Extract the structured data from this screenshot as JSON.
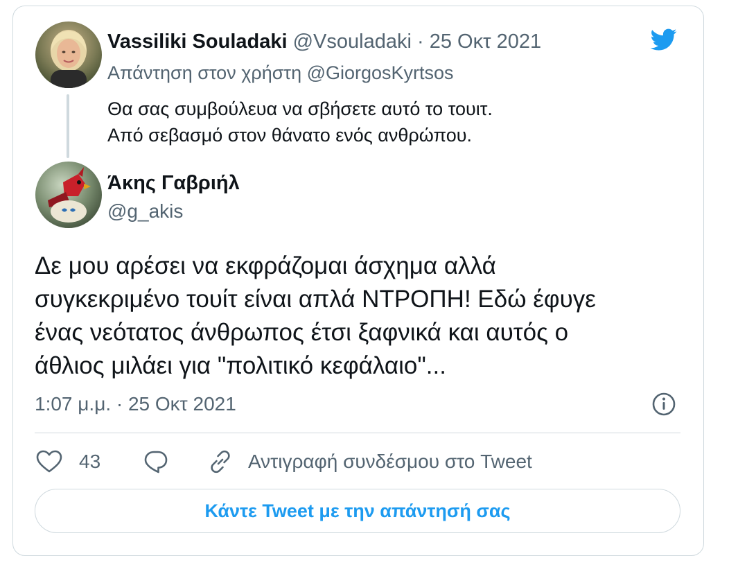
{
  "parent": {
    "name": "Vassiliki Souladaki",
    "handle": "@Vsouladaki",
    "separator": "·",
    "date": "25 Οκτ 2021",
    "reply_to": "Απάντηση στον χρήστη @GiorgosKyrtsos",
    "text_lines": [
      "Θα σας συμβούλευα να σβήσετε αυτό το τουιτ.",
      "Από σεβασμό στον θάνατο ενός ανθρώπου."
    ]
  },
  "main": {
    "name": "Άκης Γαβριήλ",
    "handle": "@g_akis",
    "text_lines": [
      "Δε μου αρέσει να εκφράζομαι άσχημα αλλά",
      "συγκεκριμένο τουίτ είναι απλά ΝΤΡΟΠΗ! Εδώ έφυγε",
      "ένας νεότατος άνθρωπος έτσι ξαφνικά και αυτός ο",
      "άθλιος μιλάει για \"πολιτικό κεφάλαιο\"..."
    ],
    "timestamp": "1:07 μ.μ. · 25 Οκτ 2021"
  },
  "actions": {
    "like_count": "43",
    "copy_link_label": "Αντιγραφή συνδέσμου στο Tweet"
  },
  "reply_button_label": "Κάντε Tweet με την απάντησή σας",
  "icons": {
    "brand": "twitter-bird-icon",
    "info": "info-icon",
    "like": "heart-icon",
    "reply": "reply-bubble-icon",
    "link": "link-icon"
  },
  "colors": {
    "accent": "#1d9bf0",
    "text": "#0f1419",
    "secondary": "#536471",
    "border": "#cfd9de"
  }
}
